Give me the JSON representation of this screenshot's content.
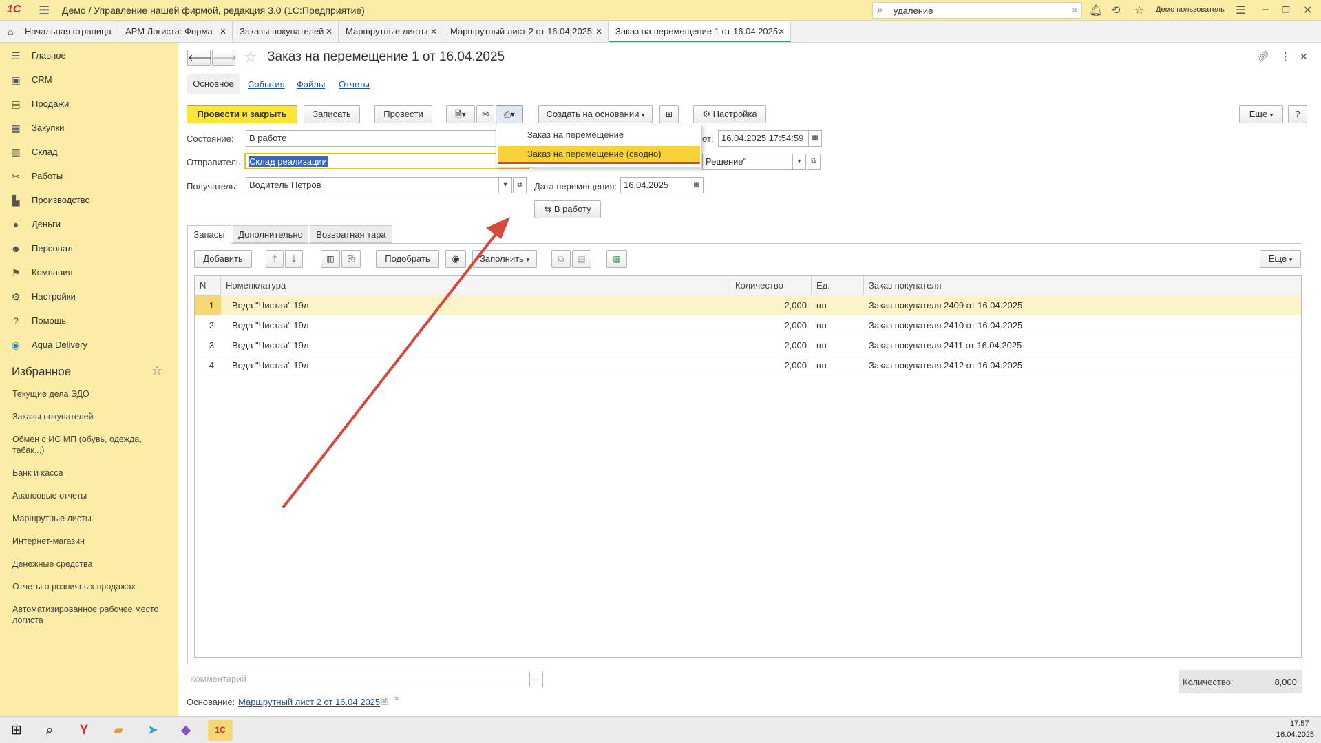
{
  "titlebar": {
    "logo": "1С",
    "title": "Демо / Управление нашей фирмой, редакция 3.0  (1С:Предприятие)",
    "search_value": "удаление",
    "user": "Демо пользователь"
  },
  "tabs": [
    {
      "label": "Начальная страница"
    },
    {
      "label": "АРМ Логиста: Форма"
    },
    {
      "label": "Заказы покупателей"
    },
    {
      "label": "Маршрутные листы"
    },
    {
      "label": "Маршрутный лист 2 от 16.04.2025"
    },
    {
      "label": "Заказ на перемещение 1 от 16.04.2025"
    }
  ],
  "sidebar": {
    "items": [
      {
        "label": "Главное",
        "icon": "menu-icon"
      },
      {
        "label": "CRM",
        "icon": "crm-icon"
      },
      {
        "label": "Продажи",
        "icon": "sales-icon"
      },
      {
        "label": "Закупки",
        "icon": "purchases-icon"
      },
      {
        "label": "Склад",
        "icon": "warehouse-icon"
      },
      {
        "label": "Работы",
        "icon": "works-icon"
      },
      {
        "label": "Производство",
        "icon": "production-icon"
      },
      {
        "label": "Деньги",
        "icon": "money-icon"
      },
      {
        "label": "Персонал",
        "icon": "staff-icon"
      },
      {
        "label": "Компания",
        "icon": "company-icon"
      },
      {
        "label": "Настройки",
        "icon": "settings-icon"
      },
      {
        "label": "Помощь",
        "icon": "help-icon"
      },
      {
        "label": "Aqua Delivery",
        "icon": "aqua-icon"
      }
    ],
    "favorites_title": "Избранное",
    "favorites": [
      "Текущие дела ЭДО",
      "Заказы покупателей",
      "Обмен с ИС МП (обувь, одежда, табак...)",
      "Банк и касса",
      "Авансовые отчеты",
      "Маршрутные листы",
      "Интернет-магазин",
      "Денежные средства",
      "Отчеты о розничных продажах",
      "Автоматизированное рабочее место логиста"
    ]
  },
  "form": {
    "title": "Заказ на перемещение 1 от 16.04.2025",
    "subtabs": [
      "Основное",
      "События",
      "Файлы",
      "Отчеты"
    ],
    "toolbar": {
      "post_close": "Провести и закрыть",
      "save": "Записать",
      "post": "Провести",
      "create_based": "Создать на основании",
      "settings": "Настройка",
      "more": "Еще",
      "help": "?"
    },
    "state_label": "Состояние:",
    "state_value": "В работе",
    "sender_label": "Отправитель:",
    "sender_value": "Склад реализации",
    "receiver_label": "Получатель:",
    "receiver_value": "Водитель Петров",
    "date_from_label": "от:",
    "date_from_value": "16.04.2025 17:54:59",
    "org_value": "Решение\"",
    "move_date_label": "Дата перемещения:",
    "move_date_value": "16.04.2025",
    "to_work_button": "В работу",
    "print_menu": [
      "Заказ на перемещение",
      "Заказ на перемещение (сводно)"
    ]
  },
  "section_tabs": [
    "Запасы",
    "Дополнительно",
    "Возвратная тара"
  ],
  "table_toolbar": {
    "add": "Добавить",
    "pick": "Подобрать",
    "fill": "Заполнить",
    "more": "Еще"
  },
  "table": {
    "columns": [
      "N",
      "Номенклатура",
      "Количество",
      "Ед.",
      "Заказ покупателя"
    ],
    "rows": [
      {
        "n": "1",
        "item": "Вода \"Чистая\" 19л",
        "qty": "2,000",
        "unit": "шт",
        "order": "Заказ покупателя 2409 от 16.04.2025"
      },
      {
        "n": "2",
        "item": "Вода \"Чистая\" 19л",
        "qty": "2,000",
        "unit": "шт",
        "order": "Заказ покупателя 2410 от 16.04.2025"
      },
      {
        "n": "3",
        "item": "Вода \"Чистая\" 19л",
        "qty": "2,000",
        "unit": "шт",
        "order": "Заказ покупателя 2411 от 16.04.2025"
      },
      {
        "n": "4",
        "item": "Вода \"Чистая\" 19л",
        "qty": "2,000",
        "unit": "шт",
        "order": "Заказ покупателя 2412 от 16.04.2025"
      }
    ]
  },
  "footer": {
    "comment_placeholder": "Комментарий",
    "qty_label": "Количество:",
    "qty_total": "8,000",
    "basis_label": "Основание:",
    "basis_link": "Маршрутный лист 2 от 16.04.2025"
  },
  "taskbar": {
    "time": "17:57",
    "date": "16.04.2025"
  }
}
